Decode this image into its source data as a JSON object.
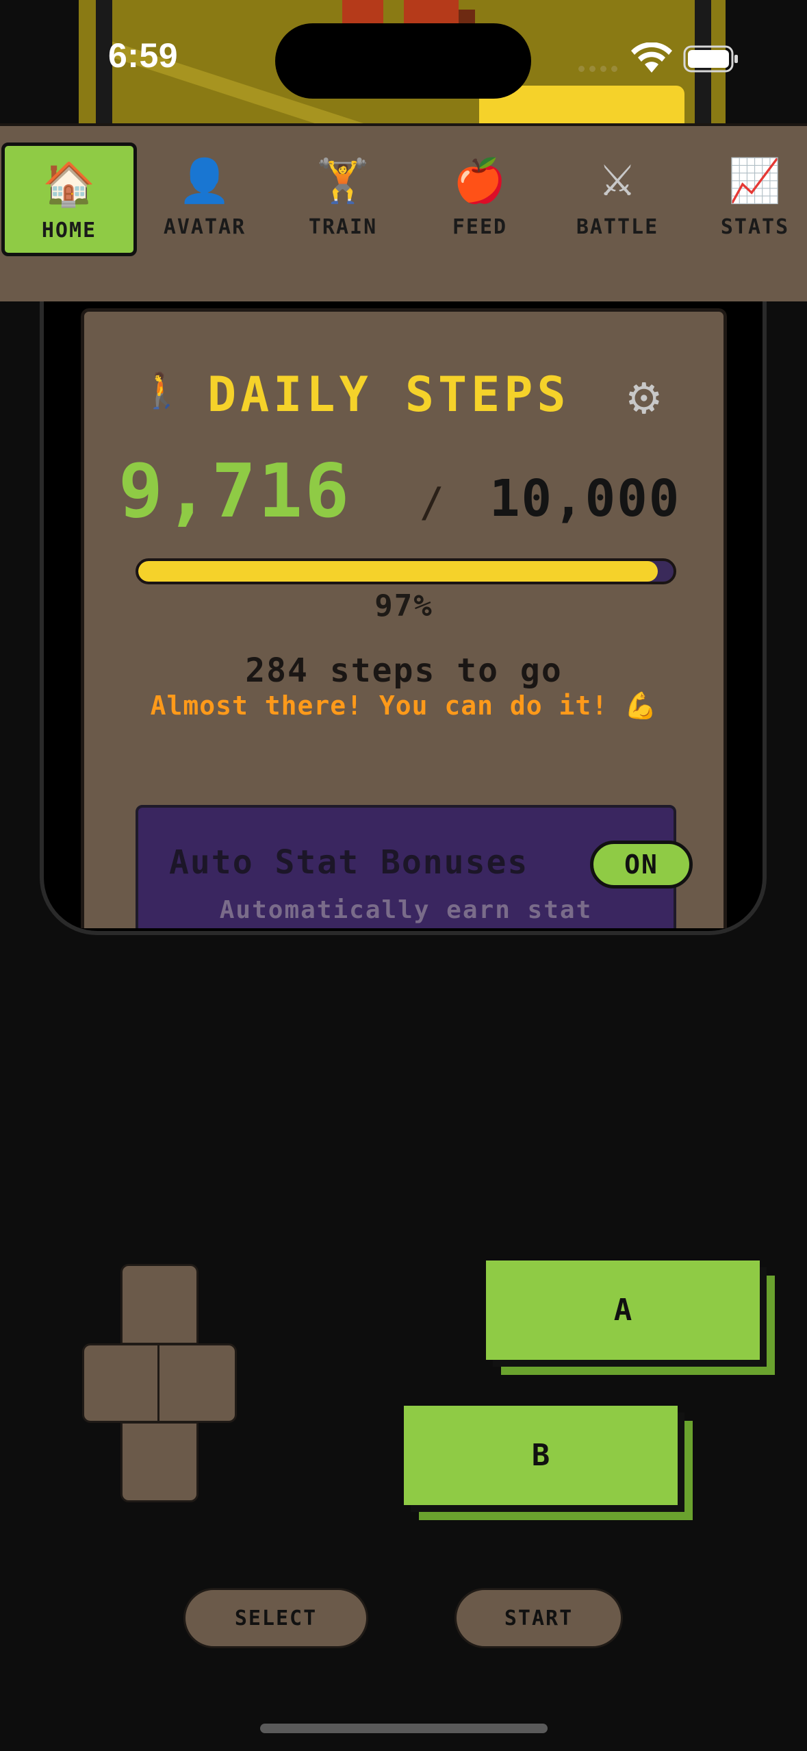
{
  "status_bar": {
    "time": "6:59"
  },
  "tabs": [
    {
      "label": "HOME",
      "icon": "🏠",
      "icon_name": "house-icon",
      "active": true
    },
    {
      "label": "AVATAR",
      "icon": "👤",
      "icon_name": "person-icon",
      "active": false
    },
    {
      "label": "TRAIN",
      "icon": "🏋",
      "icon_name": "dumbbell-icon",
      "active": false
    },
    {
      "label": "FEED",
      "icon": "🍎",
      "icon_name": "apple-icon",
      "active": false
    },
    {
      "label": "BATTLE",
      "icon": "⚔",
      "icon_name": "crossed-swords-icon",
      "active": false
    },
    {
      "label": "STATS",
      "icon": "📈",
      "icon_name": "chart-icon",
      "active": false
    }
  ],
  "steps_card": {
    "icon": "🚶",
    "title": "DAILY STEPS",
    "settings_icon": "⚙",
    "current": "9,716",
    "separator": "/",
    "goal": "10,000",
    "progress_fraction": 0.97,
    "progress_label": "97%",
    "remaining": "284 steps to go",
    "encouragement": "Almost there! You can do it! 💪"
  },
  "auto_bonus": {
    "title": "Auto Stat Bonuses",
    "toggle": "ON",
    "description": "Automatically earn stat"
  },
  "controls": {
    "a_label": "A",
    "b_label": "B",
    "select_label": "SELECT",
    "start_label": "START"
  },
  "colors": {
    "accent_green": "#8fcb45",
    "title_yellow": "#f5d22a",
    "panel_brown": "#6b5a4a",
    "bonus_purple": "#3a2660",
    "encourage_orange": "#ff9a1a"
  }
}
